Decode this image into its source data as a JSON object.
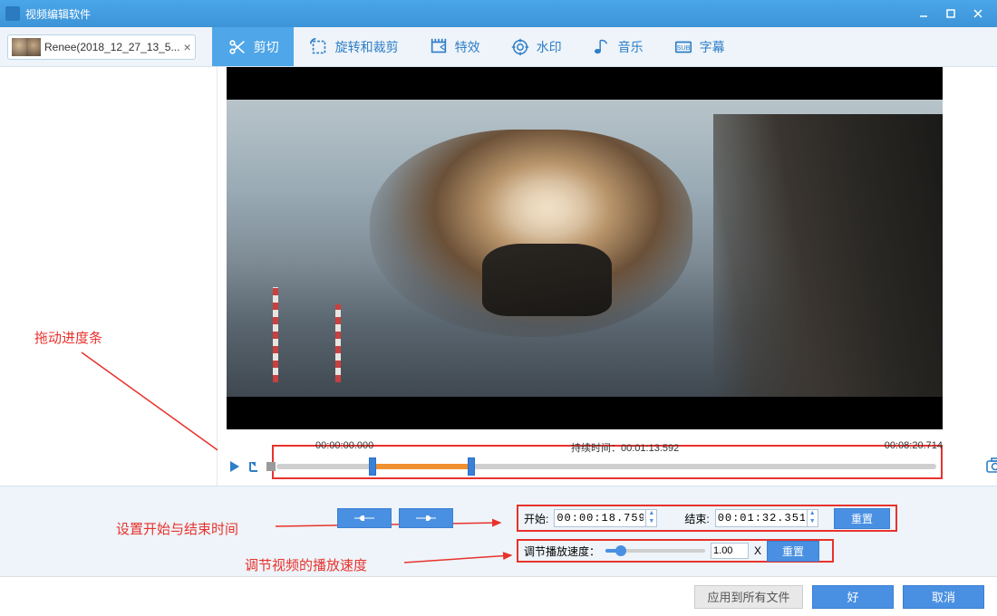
{
  "titlebar": {
    "title": "视频编辑软件"
  },
  "filetab": {
    "name": "Renee(2018_12_27_13_5..."
  },
  "tabs": [
    {
      "label": "剪切",
      "icon": "scissors",
      "active": true
    },
    {
      "label": "旋转和裁剪",
      "icon": "rotate-crop"
    },
    {
      "label": "特效",
      "icon": "effects"
    },
    {
      "label": "水印",
      "icon": "watermark"
    },
    {
      "label": "音乐",
      "icon": "music"
    },
    {
      "label": "字幕",
      "icon": "subtitle"
    }
  ],
  "timeline": {
    "start_label": "00:00:00.000",
    "duration_label": "持续时间：",
    "duration_value": "00:01:13.592",
    "total_label": "00:08:20.714",
    "sel_start_pct": 14,
    "sel_end_pct": 29
  },
  "controls": {
    "start_label": "开始:",
    "start_value": "00:00:18.759",
    "end_label": "结束:",
    "end_value": "00:01:32.351",
    "reset_label": "重置",
    "speed_label": "调节播放速度：",
    "speed_value": "1.00",
    "speed_unit": "X",
    "speed_pct": 15
  },
  "annotations": {
    "drag": "拖动进度条",
    "settime": "设置开始与结束时间",
    "speed": "调节视频的播放速度"
  },
  "footer": {
    "apply_all": "应用到所有文件",
    "ok": "好",
    "cancel": "取消"
  }
}
